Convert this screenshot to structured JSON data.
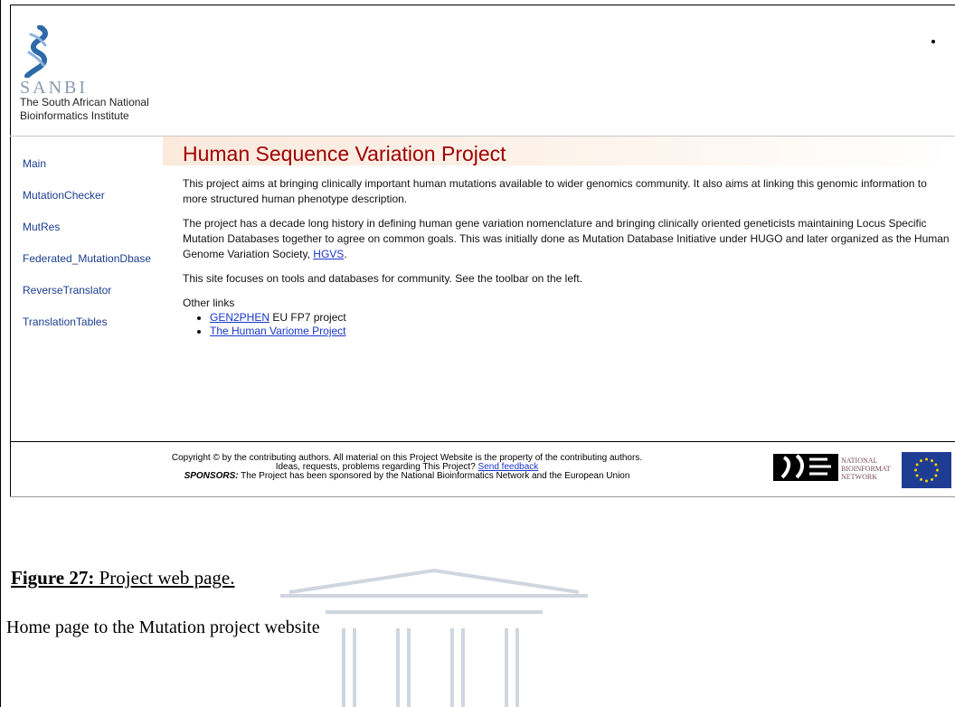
{
  "header": {
    "logo_word": "SANBI",
    "logo_line1": "The South African National",
    "logo_line2": "Bioinformatics Institute"
  },
  "sidebar": {
    "items": [
      {
        "label": "Main"
      },
      {
        "label": "MutationChecker"
      },
      {
        "label": "MutRes"
      },
      {
        "label": "Federated_MutationDbase"
      },
      {
        "label": "ReverseTranslator"
      },
      {
        "label": "TranslationTables"
      }
    ]
  },
  "main": {
    "title": "Human Sequence Variation Project",
    "p1": "This project aims at bringing clinically important human mutations available to wider genomics community. It also aims at linking this genomic information to more structured human phenotype description.",
    "p2_text": "The project has a decade long history in defining human gene variation nomenclature and bringing clinically oriented geneticists maintaining Locus Specific Mutation Databases together to agree on common goals. This was initially done as Mutation Database Initiative under HUGO and later organized as the Human Genome Variation Society, ",
    "p2_link": "HGVS",
    "p2_end": ".",
    "p3": "This site focuses on tools and databases for community. See the toolbar on the left.",
    "other_links_label": "Other links",
    "links": [
      {
        "link": "GEN2PHEN",
        "suffix": " EU FP7 project"
      },
      {
        "link": "The Human Variome Project",
        "suffix": ""
      }
    ]
  },
  "footer": {
    "line1": "Copyright © by the contributing authors. All material on this Project Website is the property of the contributing authors.",
    "line2_text": "Ideas, requests, problems regarding This Project? ",
    "line2_link": "Send feedback",
    "sponsors_label": "SPONSORS:",
    "sponsors_text": " The Project has been sponsored by the National Bioinformatics Network and the European Union",
    "nbn_line1": "NATIONAL",
    "nbn_line2": "BIOINFORMATICS",
    "nbn_line3": "NETWORK"
  },
  "caption": {
    "figure_label": "Figure 27:",
    "figure_title": " Project web page.",
    "text": "Home page to the Mutation project website"
  },
  "colors": {
    "title_red": "#a00000",
    "sidebar_link": "#1b3d8f",
    "link_blue": "#1a37c9"
  }
}
